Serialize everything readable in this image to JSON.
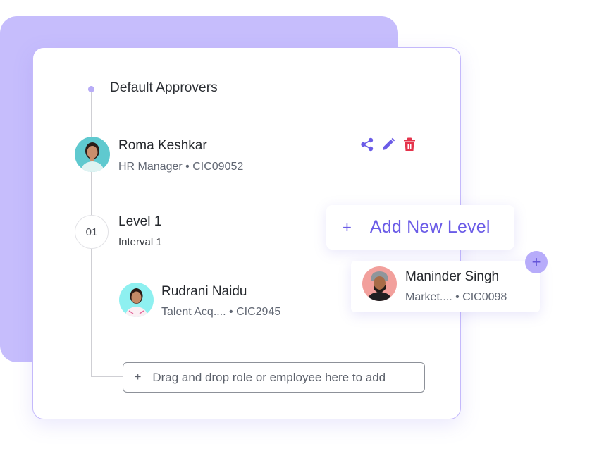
{
  "section": {
    "title": "Default Approvers"
  },
  "default_approver": {
    "name": "Roma Keshkar",
    "role": "HR Manager",
    "code": "CIC09052",
    "subtitle": "HR Manager • CIC09052",
    "avatar_bg": "#5fc9cf",
    "actions": [
      {
        "icon": "share-icon",
        "color": "#6b5ce7"
      },
      {
        "icon": "edit-pencil-icon",
        "color": "#6b5ce7"
      },
      {
        "icon": "trash-icon",
        "color": "#e5334b"
      }
    ]
  },
  "level": {
    "number": "01",
    "title": "Level 1",
    "interval": "Interval 1"
  },
  "level_approver": {
    "name": "Rudrani Naidu",
    "subtitle": "Talent Acq.... • CIC2945",
    "avatar_bg": "#8ef0f0"
  },
  "drop_zone": {
    "plus": "+",
    "text": "Drag and drop role or employee here to add"
  },
  "add_level": {
    "plus": "+",
    "label": "Add New Level"
  },
  "dragged_employee": {
    "name": "Maninder Singh",
    "subtitle": "Market.... • CIC0098",
    "avatar_bg": "#f2a09c",
    "plus": "+"
  },
  "colors": {
    "accent": "#6b5ce7",
    "accent_light": "#c6bdfc",
    "danger": "#e5334b"
  }
}
